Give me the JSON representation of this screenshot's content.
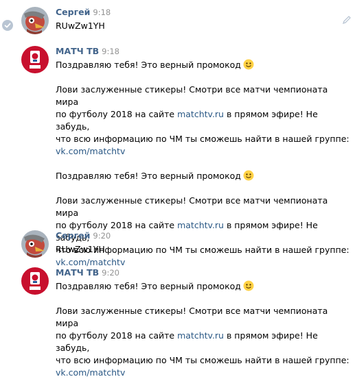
{
  "messages": [
    {
      "author": "Сергей",
      "time": "9:18",
      "text": "RUwZw1YH",
      "avatar": "sergey-avatar"
    },
    {
      "author": "МАТЧ ТВ",
      "time": "9:18",
      "avatar": "matchtv-avatar",
      "blocks": [
        {
          "promo": "Поздравляю тебя! Это верный промокод",
          "p1": "Лови заслуженные стикеры! Смотри все матчи чемпионата мира",
          "p2_a": "по футболу 2018 на сайте ",
          "p2_link": "matchtv.ru",
          "p2_b": " в прямом эфире! Не забудь,",
          "p3": "что всю информацию по ЧМ ты сможешь найти в нашей группе:",
          "group_link": "vk.com/matchtv"
        },
        {
          "promo": "Поздравляю тебя! Это верный промокод",
          "p1": "Лови заслуженные стикеры! Смотри все матчи чемпионата мира",
          "p2_a": "по футболу 2018 на сайте ",
          "p2_link": "matchtv.ru",
          "p2_b": " в прямом эфире! Не забудь,",
          "p3": "что всю информацию по ЧМ ты сможешь найти в нашей группе:",
          "group_link": "vk.com/matchtv"
        }
      ]
    },
    {
      "author": "Сергей",
      "time": "9:20",
      "text": "RUwZw1YH",
      "avatar": "sergey-avatar"
    },
    {
      "author": "МАТЧ ТВ",
      "time": "9:20",
      "avatar": "matchtv-avatar",
      "blocks": [
        {
          "promo": "Поздравляю тебя! Это верный промокод",
          "p1": "Лови заслуженные стикеры! Смотри все матчи чемпионата мира",
          "p2_a": "по футболу 2018 на сайте ",
          "p2_link": "matchtv.ru",
          "p2_b": " в прямом эфире! Не забудь,",
          "p3": "что всю информацию по ЧМ ты сможешь найти в нашей группе:",
          "group_link": "vk.com/matchtv"
        }
      ]
    }
  ],
  "colors": {
    "author": "#42648b",
    "link": "#2a5885",
    "time": "#939393",
    "matchtv_red": "#c8102e"
  },
  "icons": [
    "check-icon",
    "edit-icon",
    "smile-emoji-icon"
  ]
}
